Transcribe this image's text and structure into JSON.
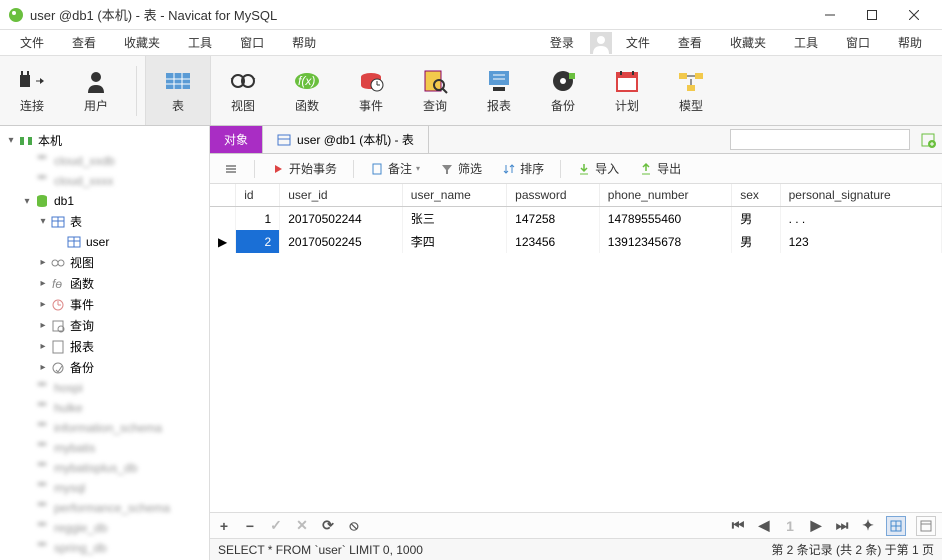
{
  "titlebar": {
    "title": "user @db1 (本机) - 表 - Navicat for MySQL"
  },
  "menubar": {
    "items": [
      "文件",
      "查看",
      "收藏夹",
      "工具",
      "窗口",
      "帮助"
    ],
    "login": "登录"
  },
  "toolbar": {
    "items": [
      {
        "label": "连接",
        "icon": "plug"
      },
      {
        "label": "用户",
        "icon": "user"
      },
      {
        "label": "表",
        "icon": "table",
        "selected": true
      },
      {
        "label": "视图",
        "icon": "view"
      },
      {
        "label": "函数",
        "icon": "fx"
      },
      {
        "label": "事件",
        "icon": "event"
      },
      {
        "label": "查询",
        "icon": "query"
      },
      {
        "label": "报表",
        "icon": "report"
      },
      {
        "label": "备份",
        "icon": "backup"
      },
      {
        "label": "计划",
        "icon": "schedule"
      },
      {
        "label": "模型",
        "icon": "model"
      }
    ]
  },
  "sidebar": {
    "root_label": "本机",
    "db1_label": "db1",
    "tables_label": "表",
    "user_table": "user",
    "views_label": "视图",
    "functions_label": "函数",
    "events_label": "事件",
    "queries_label": "查询",
    "reports_label": "报表",
    "backups_label": "备份"
  },
  "tabs": {
    "objects": "对象",
    "table_tab": "user @db1 (本机) - 表",
    "search_placeholder": ""
  },
  "subtoolbar": {
    "begin_transaction": "开始事务",
    "memo": "备注",
    "filter": "筛选",
    "sort": "排序",
    "import": "导入",
    "export": "导出"
  },
  "table": {
    "columns": [
      "id",
      "user_id",
      "user_name",
      "password",
      "phone_number",
      "sex",
      "personal_signature"
    ],
    "rows": [
      {
        "id": "1",
        "user_id": "20170502244",
        "user_name": "张三",
        "password": "147258",
        "phone_number": "14789555460",
        "sex": "男",
        "personal_signature": ". . ."
      },
      {
        "id": "2",
        "user_id": "20170502245",
        "user_name": "李四",
        "password": "123456",
        "phone_number": "13912345678",
        "sex": "男",
        "personal_signature": "123"
      }
    ],
    "selected_row": 1
  },
  "statusbar": {
    "sql": "SELECT * FROM `user` LIMIT 0, 1000",
    "info": "第 2 条记录 (共 2 条) 于第 1 页"
  }
}
